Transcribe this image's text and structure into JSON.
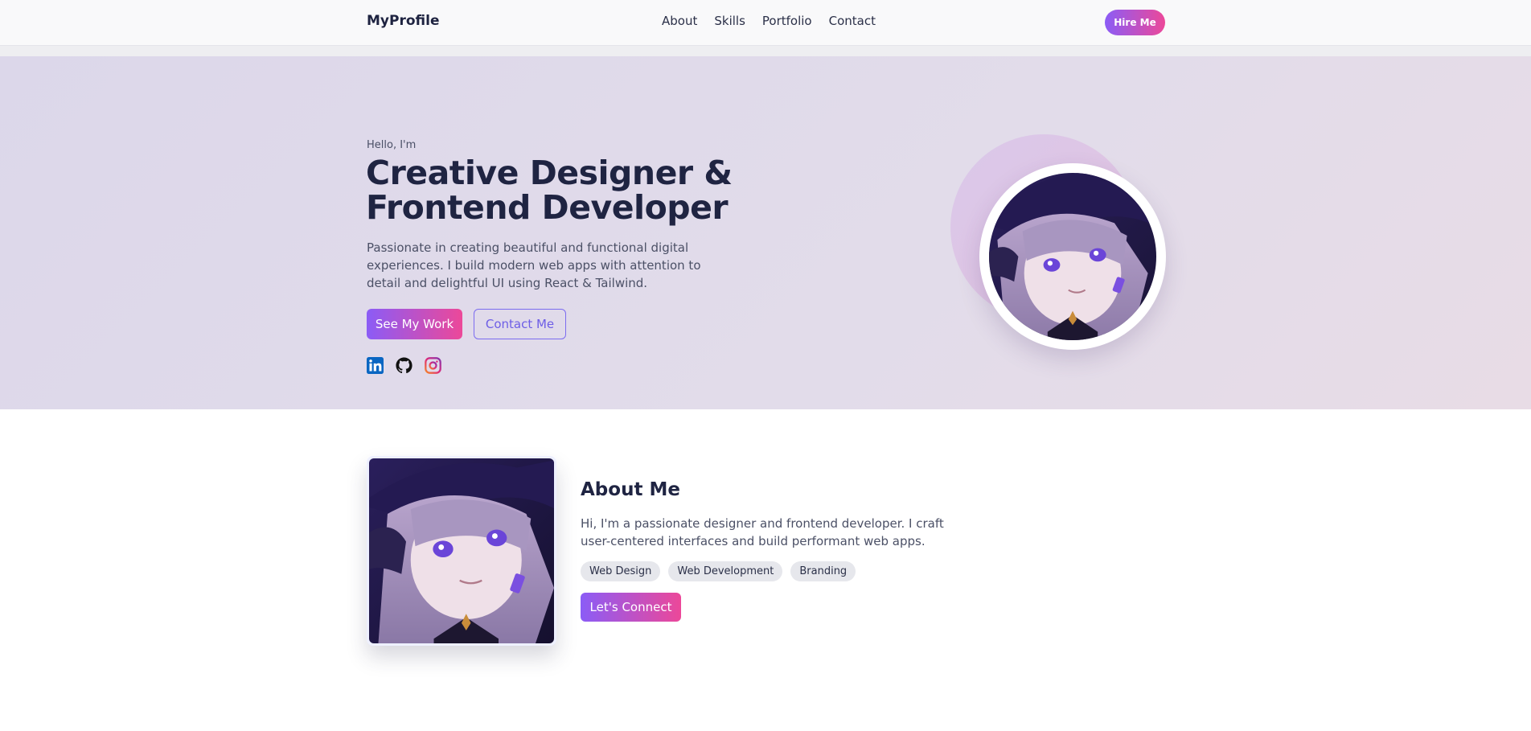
{
  "nav": {
    "brand": "MyProfile",
    "links": [
      "About",
      "Skills",
      "Portfolio",
      "Contact"
    ],
    "cta": "Hire Me"
  },
  "hero": {
    "greeting": "Hello, I'm",
    "headline_line1": "Creative Designer &",
    "headline_line2": "Frontend Developer",
    "description": "Passionate in creating beautiful and functional digital experiences. I build modern web apps with attention to detail and delightful UI using React & Tailwind.",
    "primary_button": "See My Work",
    "secondary_button": "Contact Me",
    "socials": [
      "linkedin-icon",
      "github-icon",
      "instagram-icon"
    ]
  },
  "about": {
    "title": "About Me",
    "description": "Hi, I'm a passionate designer and frontend developer. I craft user-centered interfaces and build performant web apps.",
    "tags": [
      "Web Design",
      "Web Development",
      "Branding"
    ],
    "button": "Let's Connect"
  },
  "colors": {
    "accent_start": "#8b5cf6",
    "accent_end": "#ec4899",
    "heading": "#1f2442"
  }
}
